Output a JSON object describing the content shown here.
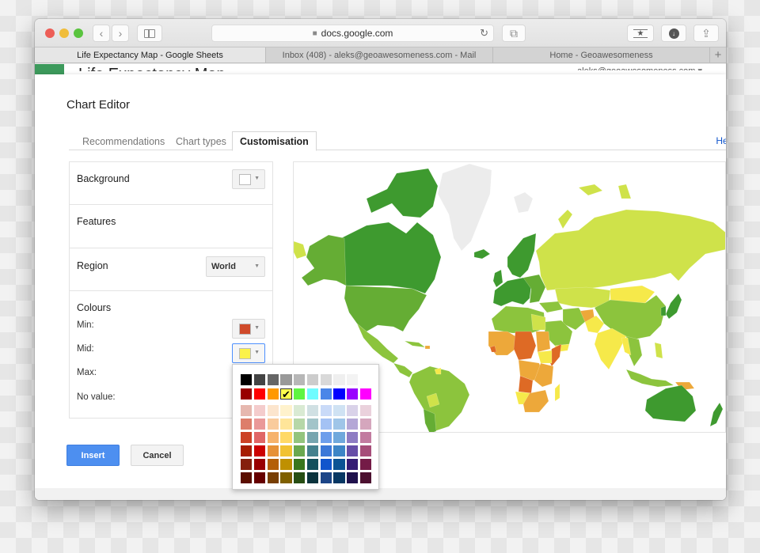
{
  "browser": {
    "url": "docs.google.com",
    "tabs": [
      {
        "label": "Life Expectancy Map - Google Sheets",
        "active": true
      },
      {
        "label": "Inbox (408) - aleks@geoawesomeness.com - Mail",
        "active": false
      },
      {
        "label": "Home - Geoawesomeness",
        "active": false
      }
    ],
    "new_tab": "+",
    "icons": {
      "back": "‹",
      "forward": "›",
      "sidebar": "▯",
      "lock": "🔒",
      "reload": "↻",
      "tabs_overview": "⧉",
      "bookmark": "★",
      "download": "⬇",
      "share": "⇪"
    }
  },
  "sheets": {
    "title": "Life Expectancy Map",
    "user": "aleks@geoawesomeness.com ▾"
  },
  "dialog": {
    "title": "Chart Editor",
    "tabs": [
      {
        "label": "Recommendations",
        "active": false
      },
      {
        "label": "Chart types",
        "active": false
      },
      {
        "label": "Customisation",
        "active": true
      }
    ],
    "help": "Help",
    "panel": {
      "background_label": "Background",
      "background_color": "#ffffff",
      "features_label": "Features",
      "region_label": "Region",
      "region_value": "World",
      "colours_label": "Colours",
      "min_label": "Min:",
      "min_color": "#d04a2a",
      "mid_label": "Mid:",
      "mid_color": "#fbf24a",
      "max_label": "Max:",
      "no_value_label": "No value:"
    },
    "insert_label": "Insert",
    "cancel_label": "Cancel"
  },
  "palette": {
    "selected": "#ffff4d",
    "check": "✔",
    "rows": [
      [
        "#000000",
        "#444444",
        "#666666",
        "#999999",
        "#b7b7b7",
        "#cccccc",
        "#d9d9d9",
        "#efefef",
        "#f3f3f3",
        "#ffffff"
      ],
      [
        "#980000",
        "#ff0000",
        "#ff9900",
        "#ffff4d",
        "#5ff542",
        "#6ffcff",
        "#4a86e8",
        "#0000ff",
        "#9900ff",
        "#ff00ff"
      ],
      [
        "#e6b8af",
        "#f4cccc",
        "#fce5cd",
        "#fff2cc",
        "#d9ead3",
        "#d0e0e3",
        "#c9daf8",
        "#cfe2f3",
        "#d9d2e9",
        "#ead1dc"
      ],
      [
        "#dd7e6b",
        "#ea9999",
        "#f9cb9c",
        "#ffe599",
        "#b6d7a8",
        "#a2c4c9",
        "#a4c2f4",
        "#9fc5e8",
        "#b4a7d6",
        "#d5a6bd"
      ],
      [
        "#cc4125",
        "#e06666",
        "#f6b26b",
        "#ffd966",
        "#93c47d",
        "#76a5af",
        "#6d9eeb",
        "#6fa8dc",
        "#8e7cc3",
        "#c27ba0"
      ],
      [
        "#a61c00",
        "#cc0000",
        "#e69138",
        "#f1c232",
        "#6aa84f",
        "#45818e",
        "#3c78d8",
        "#3d85c6",
        "#674ea7",
        "#a64d79"
      ],
      [
        "#85200c",
        "#990000",
        "#b45f06",
        "#bf9000",
        "#38761d",
        "#134f5c",
        "#1155cc",
        "#0b5394",
        "#351c75",
        "#741b47"
      ],
      [
        "#5b0f00",
        "#660000",
        "#783f04",
        "#7f6000",
        "#274e13",
        "#0c343d",
        "#1c4587",
        "#073763",
        "#20124d",
        "#4c1130"
      ]
    ]
  },
  "map": {
    "region": "World",
    "colors": {
      "high": "#3e9a2f",
      "upper": "#65ad34",
      "mid_green": "#8cc43d",
      "yellow_green": "#cfe24a",
      "yellow": "#f6e94a",
      "orange": "#eda83a",
      "dark_orange": "#de6a25",
      "no_value": "#ececec"
    }
  }
}
